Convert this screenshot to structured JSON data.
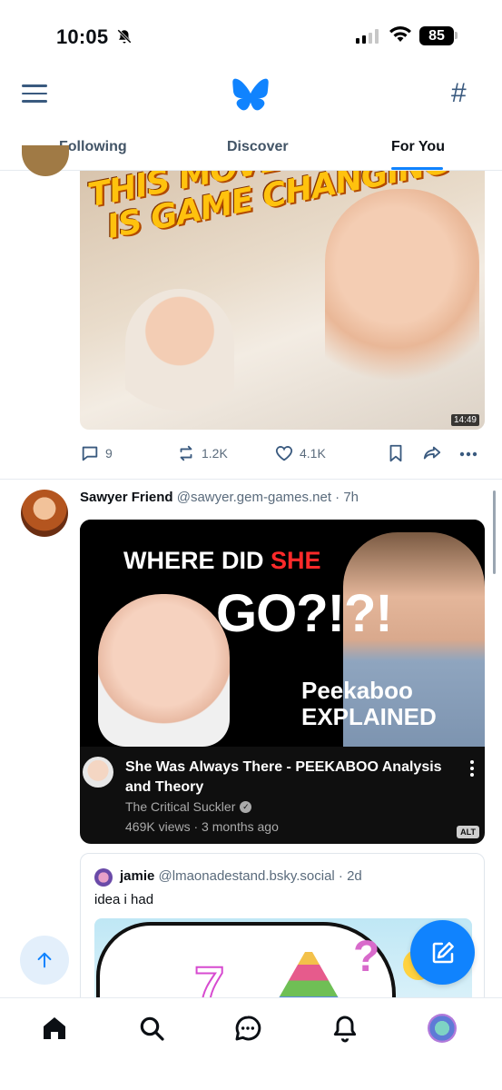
{
  "status_bar": {
    "time": "10:05",
    "battery": "85",
    "icons": [
      "bell-off-icon",
      "cellular-signal-icon",
      "wifi-icon",
      "battery-icon"
    ]
  },
  "header": {
    "menu_icon": "hamburger-menu-icon",
    "logo_icon": "bluesky-butterfly-logo",
    "feeds_icon": "hashtag-icon",
    "tabs": [
      {
        "label": "Following",
        "active": false
      },
      {
        "label": "Discover",
        "active": false
      },
      {
        "label": "For You",
        "active": true
      }
    ]
  },
  "posts": [
    {
      "thumbnail": {
        "caption_line1": "THIS MOVEMENT TECH",
        "caption_line2": "IS GAME CHANGING",
        "duration": "14:49"
      },
      "actions": {
        "replies": "9",
        "reposts": "1.2K",
        "likes": "4.1K"
      }
    },
    {
      "author_name": "Sawyer Friend",
      "author_handle": "@sawyer.gem-games.net · 7h",
      "video": {
        "thumb_where": "WHERE DID ",
        "thumb_she": "SHE",
        "thumb_go": "GO?!?!",
        "thumb_peek_line1": "Peekaboo",
        "thumb_peek_line2": "EXPLAINED",
        "title": "She Was Always There - PEEKABOO Analysis and Theory",
        "channel": "The Critical Suckler",
        "meta": "469K views · 3 months ago",
        "alt_badge": "ALT"
      },
      "quote": {
        "author_name": "jamie",
        "author_handle": "@lmaonadestand.bsky.social · 2d",
        "text": "idea i had"
      }
    }
  ],
  "bottom_nav": {
    "items": [
      "home-icon",
      "search-icon",
      "chat-icon",
      "notifications-icon",
      "profile-avatar"
    ]
  },
  "colors": {
    "accent": "#1083fe",
    "text": "#0b0f14",
    "muted": "#5a6b7c",
    "icon_blue": "#3a5a7f"
  }
}
